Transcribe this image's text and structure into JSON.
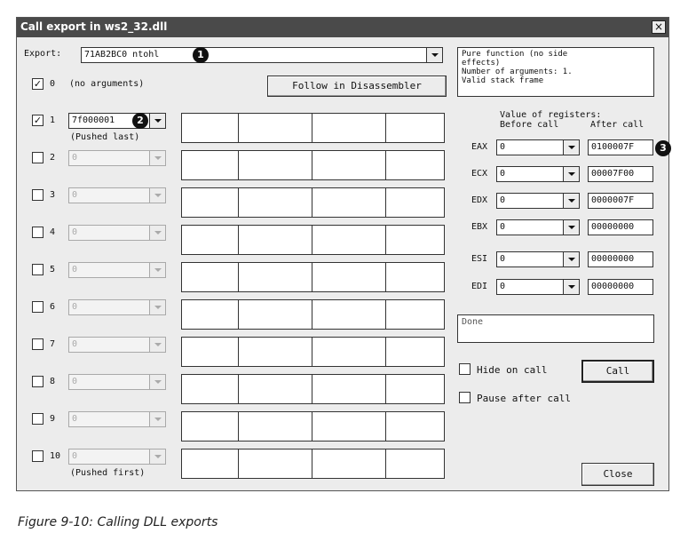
{
  "window": {
    "title": "Call export in ws2_32.dll",
    "close_glyph": "×"
  },
  "export": {
    "label": "Export:",
    "value": "71AB2BC0  ntohl"
  },
  "info_text": "Pure function (no side\neffects)\nNumber of arguments: 1.\nValid stack frame",
  "no_args": {
    "number": "0",
    "text": "(no arguments)",
    "checked": true
  },
  "follow_button": "Follow in Disassembler",
  "args": [
    {
      "number": "1",
      "value": "7f000001",
      "checked": true,
      "enabled": true,
      "note": "(Pushed last)"
    },
    {
      "number": "2",
      "value": "0",
      "checked": false,
      "enabled": false,
      "note": ""
    },
    {
      "number": "3",
      "value": "0",
      "checked": false,
      "enabled": false,
      "note": ""
    },
    {
      "number": "4",
      "value": "0",
      "checked": false,
      "enabled": false,
      "note": ""
    },
    {
      "number": "5",
      "value": "0",
      "checked": false,
      "enabled": false,
      "note": ""
    },
    {
      "number": "6",
      "value": "0",
      "checked": false,
      "enabled": false,
      "note": ""
    },
    {
      "number": "7",
      "value": "0",
      "checked": false,
      "enabled": false,
      "note": ""
    },
    {
      "number": "8",
      "value": "0",
      "checked": false,
      "enabled": false,
      "note": ""
    },
    {
      "number": "9",
      "value": "0",
      "checked": false,
      "enabled": false,
      "note": ""
    },
    {
      "number": "10",
      "value": "0",
      "checked": false,
      "enabled": false,
      "note": "(Pushed first)"
    }
  ],
  "registers": {
    "heading": "Value of registers:",
    "before_label": "Before call",
    "after_label": "After call",
    "rows": [
      {
        "name": "EAX",
        "before": "0",
        "after": "0100007F"
      },
      {
        "name": "ECX",
        "before": "0",
        "after": "00007F00"
      },
      {
        "name": "EDX",
        "before": "0",
        "after": "0000007F"
      },
      {
        "name": "EBX",
        "before": "0",
        "after": "00000000"
      },
      {
        "name": "ESI",
        "before": "0",
        "after": "00000000"
      },
      {
        "name": "EDI",
        "before": "0",
        "after": "00000000"
      }
    ]
  },
  "status_text": "Done",
  "hide_on_call": {
    "label": "Hide on call",
    "checked": false
  },
  "pause_after_call": {
    "label": "Pause after call",
    "checked": false
  },
  "call_button": "Call",
  "close_button": "Close",
  "markers": [
    "1",
    "2",
    "3"
  ],
  "caption": "Figure 9-10: Calling DLL exports"
}
